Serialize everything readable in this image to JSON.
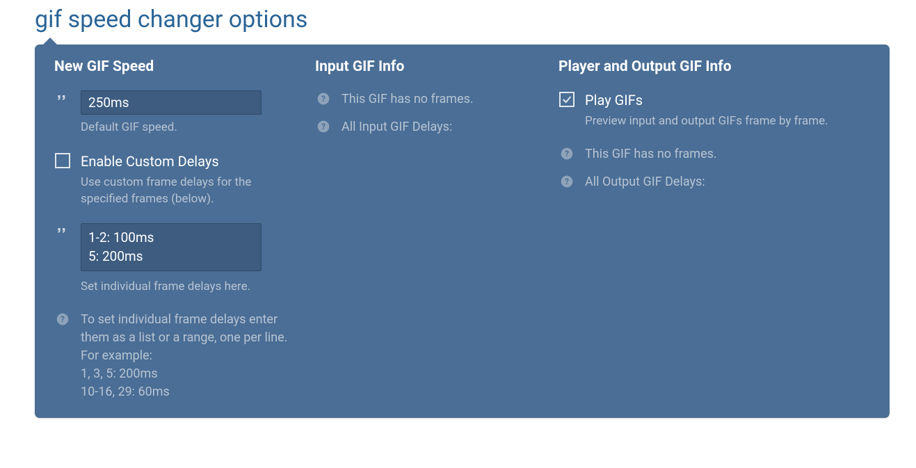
{
  "title": "gif speed changer options",
  "col1": {
    "heading": "New GIF Speed",
    "speed_value": "250ms",
    "speed_hint": "Default GIF speed.",
    "enable_custom_label": "Enable Custom Delays",
    "enable_custom_hint": "Use custom frame delays for the specified frames (below).",
    "enable_custom_checked": false,
    "custom_delays_value": "1-2: 100ms\n5: 200ms",
    "custom_delays_hint": "Set individual frame delays here.",
    "help_text": "To set individual frame delays enter them as a list or a range, one per line. For example:\n1, 3, 5: 200ms\n10-16, 29: 60ms"
  },
  "col2": {
    "heading": "Input GIF Info",
    "no_frames": "This GIF has no frames.",
    "all_delays": "All Input GIF Delays:"
  },
  "col3": {
    "heading": "Player and Output GIF Info",
    "play_label": "Play GIFs",
    "play_checked": true,
    "play_hint": "Preview input and output GIFs frame by frame.",
    "no_frames": "This GIF has no frames.",
    "all_delays": "All Output GIF Delays:"
  }
}
